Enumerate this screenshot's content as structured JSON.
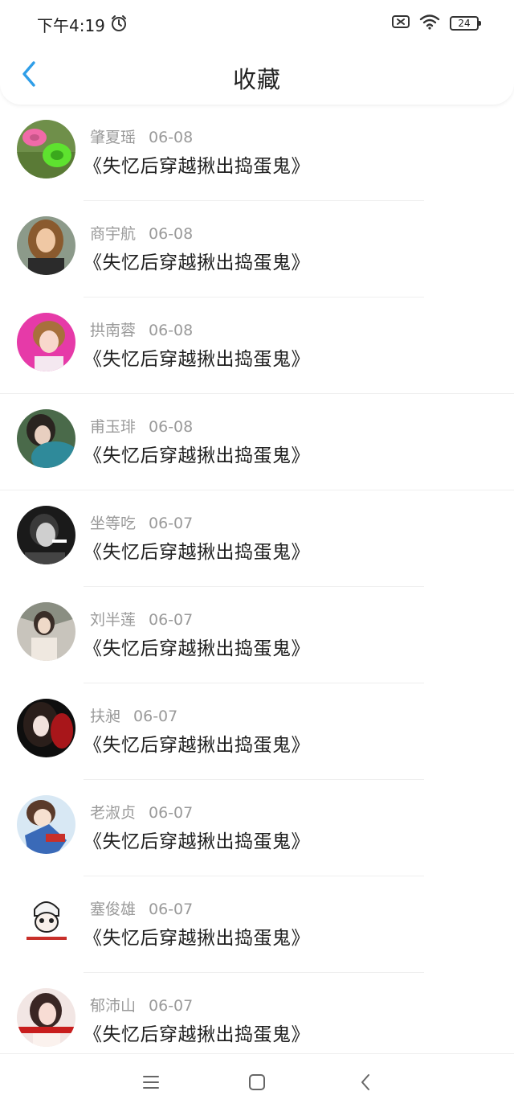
{
  "status_bar": {
    "time": "下午4:19",
    "battery": "24"
  },
  "header": {
    "title": "收藏"
  },
  "items": [
    {
      "name": "肇夏瑶",
      "date": "06-08",
      "title": "《失忆后穿越揪出捣蛋鬼》"
    },
    {
      "name": "商宇航",
      "date": "06-08",
      "title": "《失忆后穿越揪出捣蛋鬼》"
    },
    {
      "name": "拱南蓉",
      "date": "06-08",
      "title": "《失忆后穿越揪出捣蛋鬼》"
    },
    {
      "name": "甫玉琲",
      "date": "06-08",
      "title": "《失忆后穿越揪出捣蛋鬼》"
    },
    {
      "name": "坐等吃",
      "date": "06-07",
      "title": "《失忆后穿越揪出捣蛋鬼》"
    },
    {
      "name": "刘半莲",
      "date": "06-07",
      "title": "《失忆后穿越揪出捣蛋鬼》"
    },
    {
      "name": "扶昶",
      "date": "06-07",
      "title": "《失忆后穿越揪出捣蛋鬼》"
    },
    {
      "name": "老淑贞",
      "date": "06-07",
      "title": "《失忆后穿越揪出捣蛋鬼》"
    },
    {
      "name": "塞俊雄",
      "date": "06-07",
      "title": "《失忆后穿越揪出捣蛋鬼》"
    },
    {
      "name": "郁沛山",
      "date": "06-07",
      "title": "《失忆后穿越揪出捣蛋鬼》"
    }
  ],
  "colors": {
    "accent": "#2f9ee8",
    "name_text": "#9a9a9a",
    "title_text": "#1f1f1f"
  },
  "icons": {
    "back": "chevron-left-icon",
    "alarm": "alarm-icon",
    "sim": "sim-off-icon",
    "wifi": "wifi-icon",
    "menu": "menu-icon",
    "home": "home-icon",
    "back_nav": "back-icon"
  }
}
